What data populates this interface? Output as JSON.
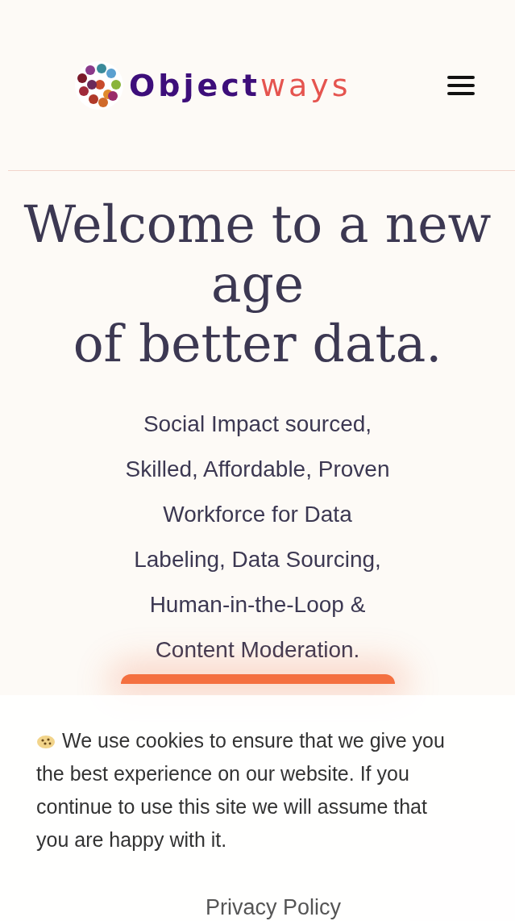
{
  "header": {
    "logo": {
      "part_1": "Object",
      "part_2": "ways"
    }
  },
  "hero": {
    "heading_lines": [
      "Welcome to a new",
      "age",
      "of better data."
    ],
    "subtitle_lines": [
      "Social Impact sourced,",
      "Skilled, Affordable, Proven",
      "Workforce for Data",
      "Labeling, Data Sourcing,",
      "Human-in-the-Loop &",
      "Content Moderation."
    ]
  },
  "cookie_banner": {
    "text_lines": [
      "We use cookies to ensure that we give you",
      "the best experience on our website. If you",
      "continue to use this site we will assume that",
      "you are happy with it."
    ],
    "link": "Privacy Policy"
  }
}
